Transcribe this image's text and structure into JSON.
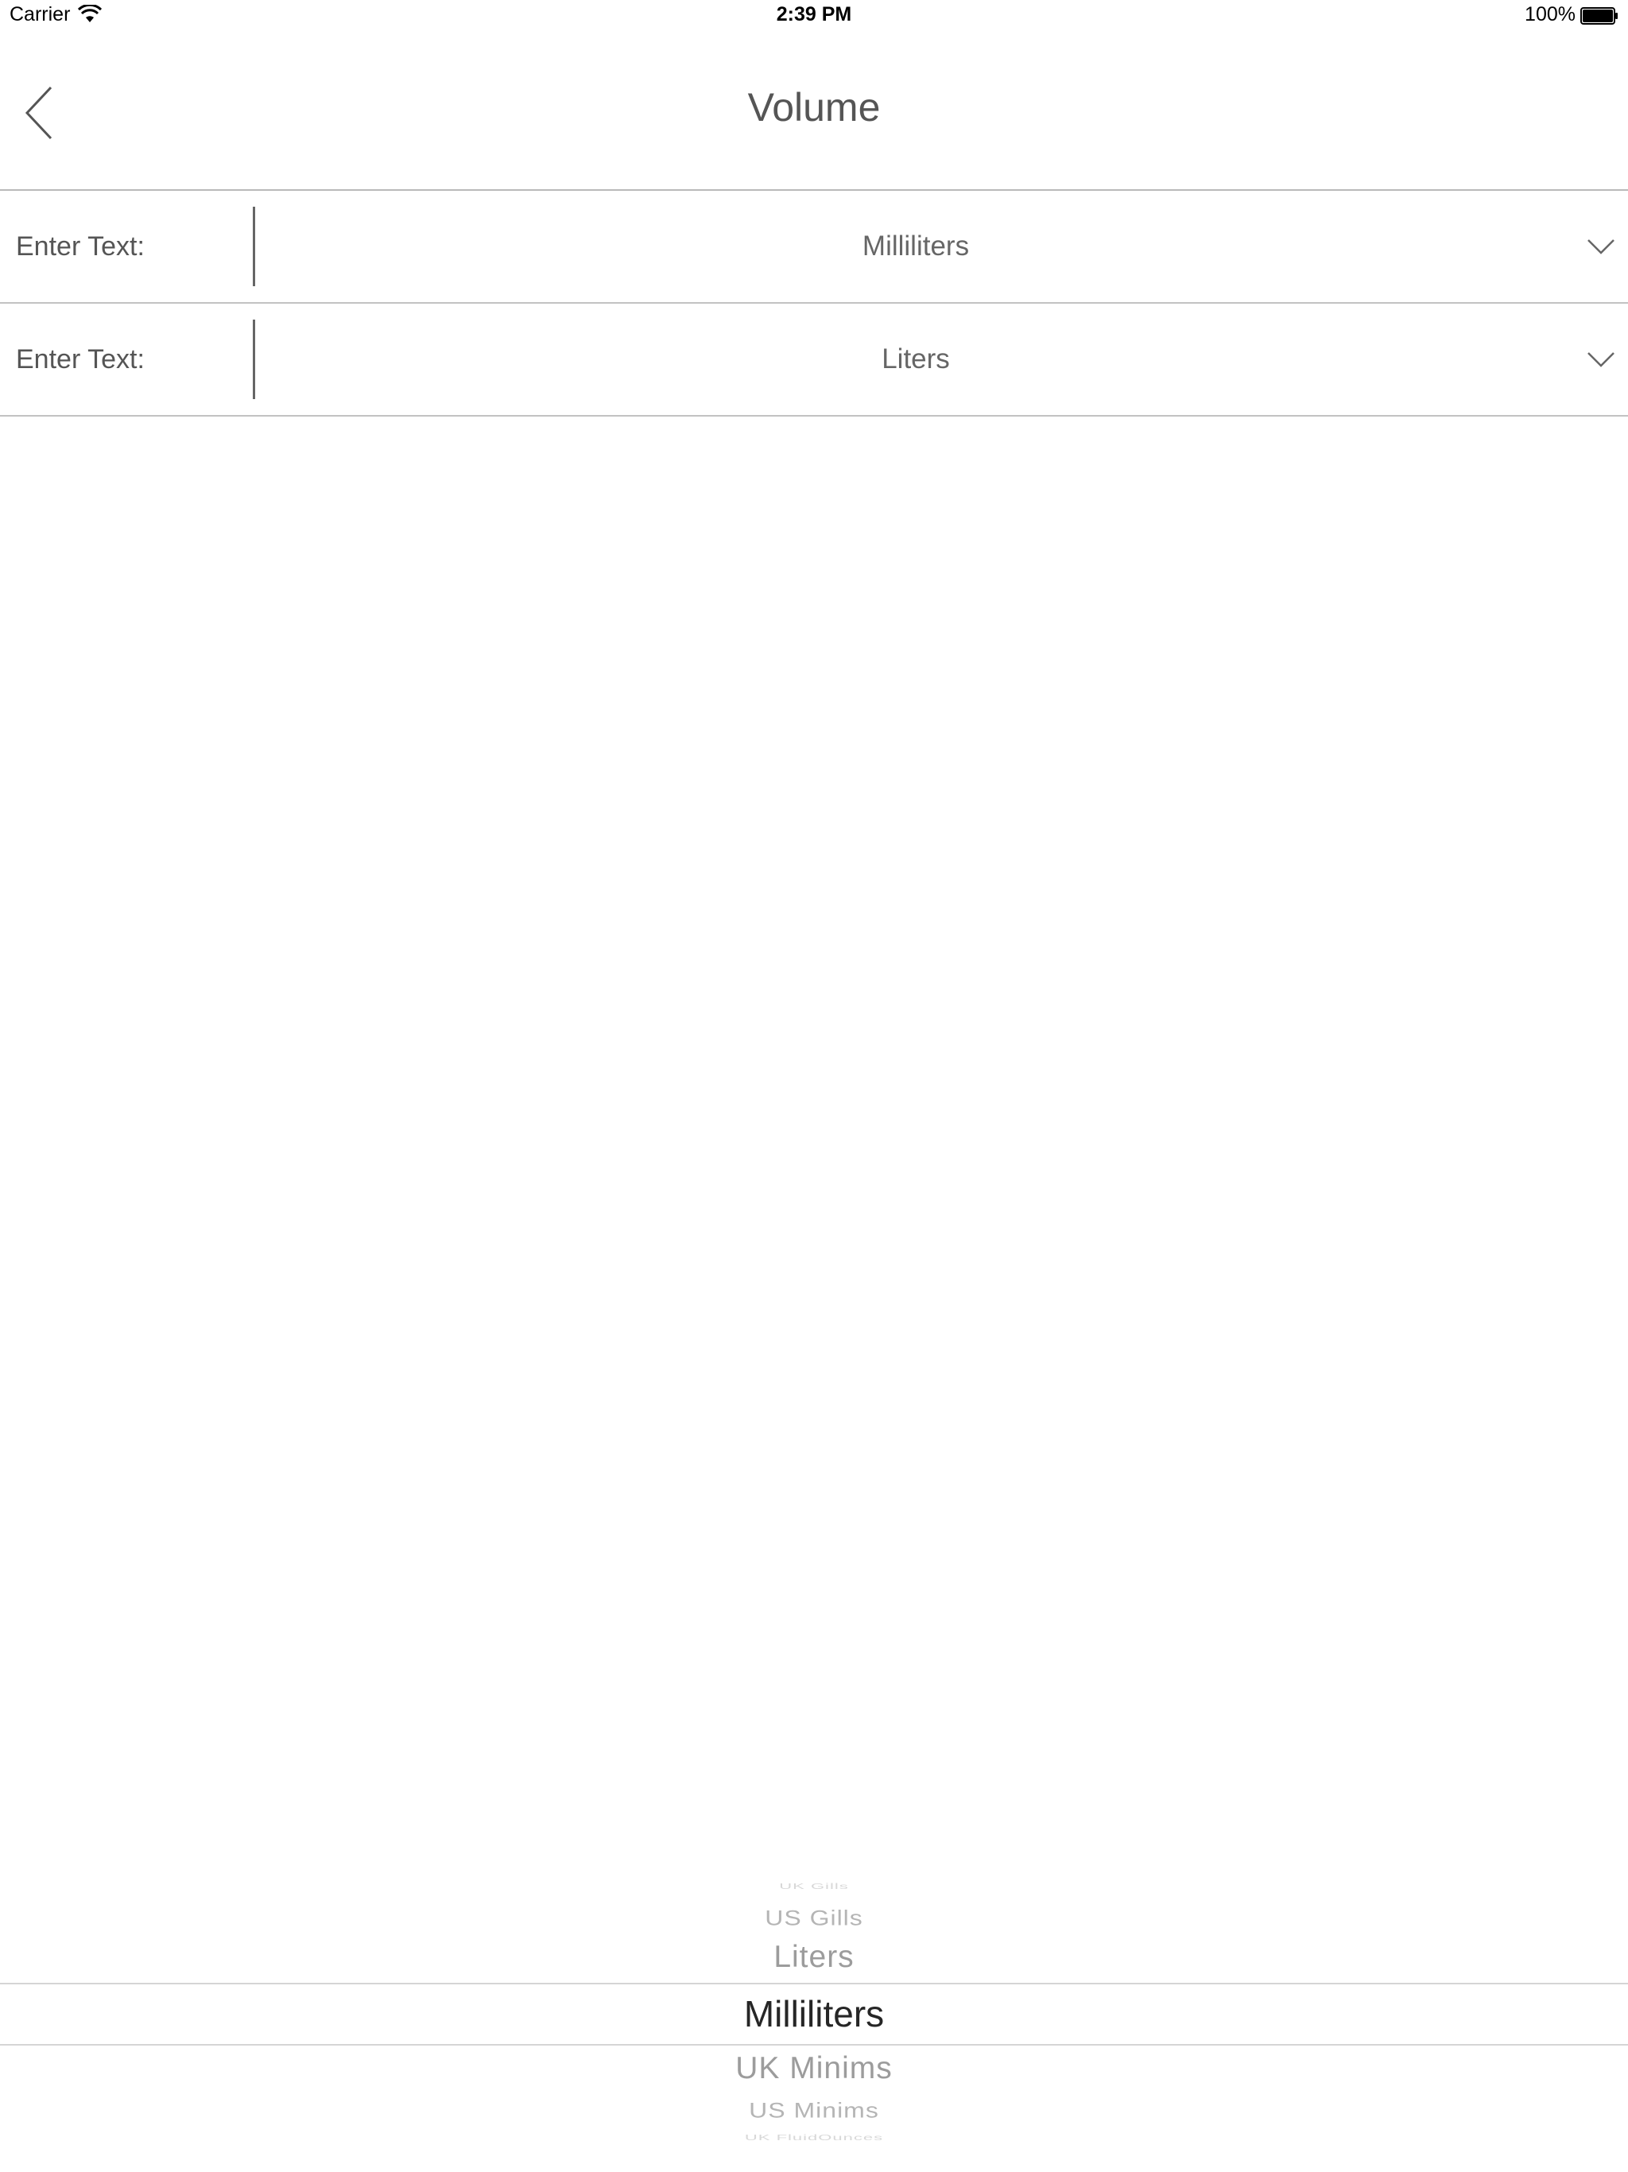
{
  "status_bar": {
    "carrier": "Carrier",
    "time": "2:39 PM",
    "battery": "100%"
  },
  "nav": {
    "title": "Volume",
    "back_icon": "chevron-left-icon"
  },
  "rows": [
    {
      "input_placeholder": "Enter Text:",
      "input_value": "",
      "unit": "Milliliters",
      "dropdown_icon": "chevron-down-icon"
    },
    {
      "input_placeholder": "Enter Text:",
      "input_value": "",
      "unit": "Liters",
      "dropdown_icon": "chevron-down-icon"
    }
  ],
  "picker": {
    "items": [
      "UK Gills",
      "US Gills",
      "Liters",
      "Milliliters",
      "UK Minims",
      "US Minims",
      "UK FluidOunces"
    ],
    "selected": "Milliliters"
  }
}
